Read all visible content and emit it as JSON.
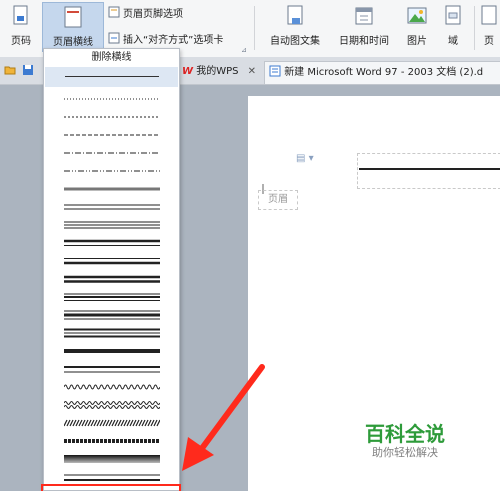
{
  "ribbon": {
    "page_number_label": "页码",
    "header_line_label": "页眉横线",
    "header_footer_options_label": "页眉页脚选项",
    "insert_align_tab_label": "插入“对齐方式”选项卡",
    "auto_figure_label": "自动图文集",
    "datetime_label": "日期和时间",
    "picture_label": "图片",
    "field_label": "域",
    "right_cut_label": "页"
  },
  "tabs": {
    "wps_tab_label": "我的WPS",
    "doc_tab_label": "新建 Microsoft Word 97 - 2003 文档 (2).d"
  },
  "dropdown": {
    "remove_label": "删除横线",
    "line_style_count": 22
  },
  "document": {
    "header_tag": "页眉"
  },
  "watermark": {
    "title": "百科全说",
    "subtitle": "助你轻松解决"
  },
  "colors": {
    "accent_red": "#ff2a1c",
    "watermark_green": "#2e9b3a",
    "active_bg": "#c5d7ed"
  }
}
